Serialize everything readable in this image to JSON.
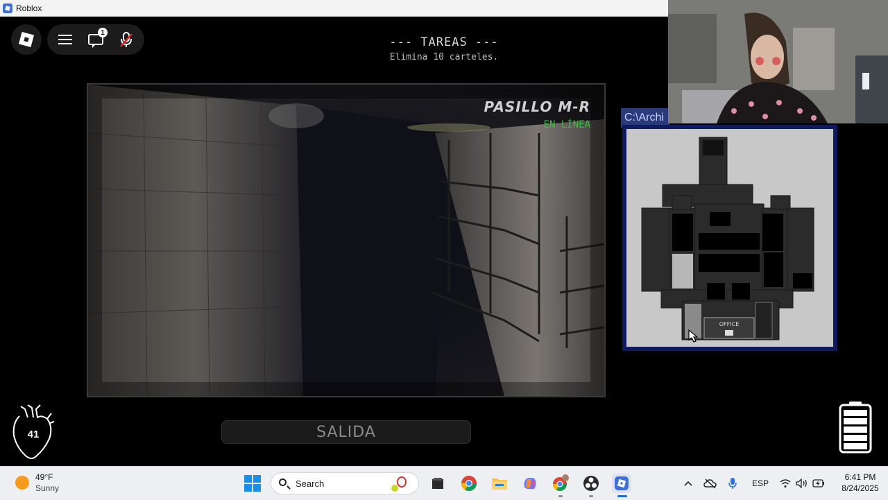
{
  "window": {
    "title": "Roblox"
  },
  "roblox_ui": {
    "chat_badge": "1"
  },
  "hud": {
    "tasks_title": "--- TAREAS ---",
    "tasks_description": "Elimina 10 carteles.",
    "camera_name": "PASILLO M-R",
    "camera_status": "EN LÍNEA",
    "exit_label": "SALIDA",
    "heart_rate": "41",
    "battery_fraction": 1.0
  },
  "map": {
    "window_title": "C:\\Archi",
    "office_label": "OFFICE"
  },
  "taskbar": {
    "weather_temp": "49°F",
    "weather_condition": "Sunny",
    "search_placeholder": "Search",
    "language": "ESP",
    "time": "6:41 PM",
    "date": "8/24/2025",
    "apps": [
      "file-explorer-dark-icon",
      "chrome-icon",
      "file-explorer-icon",
      "copilot-icon",
      "chrome-profile-icon",
      "obs-icon",
      "roblox-icon"
    ]
  },
  "colors": {
    "camera_status": "#3fbf3f",
    "map_frame": "#0e1a5c",
    "taskbar_bg": "#eeeff3",
    "accent_windows": "#1b8fe8"
  }
}
